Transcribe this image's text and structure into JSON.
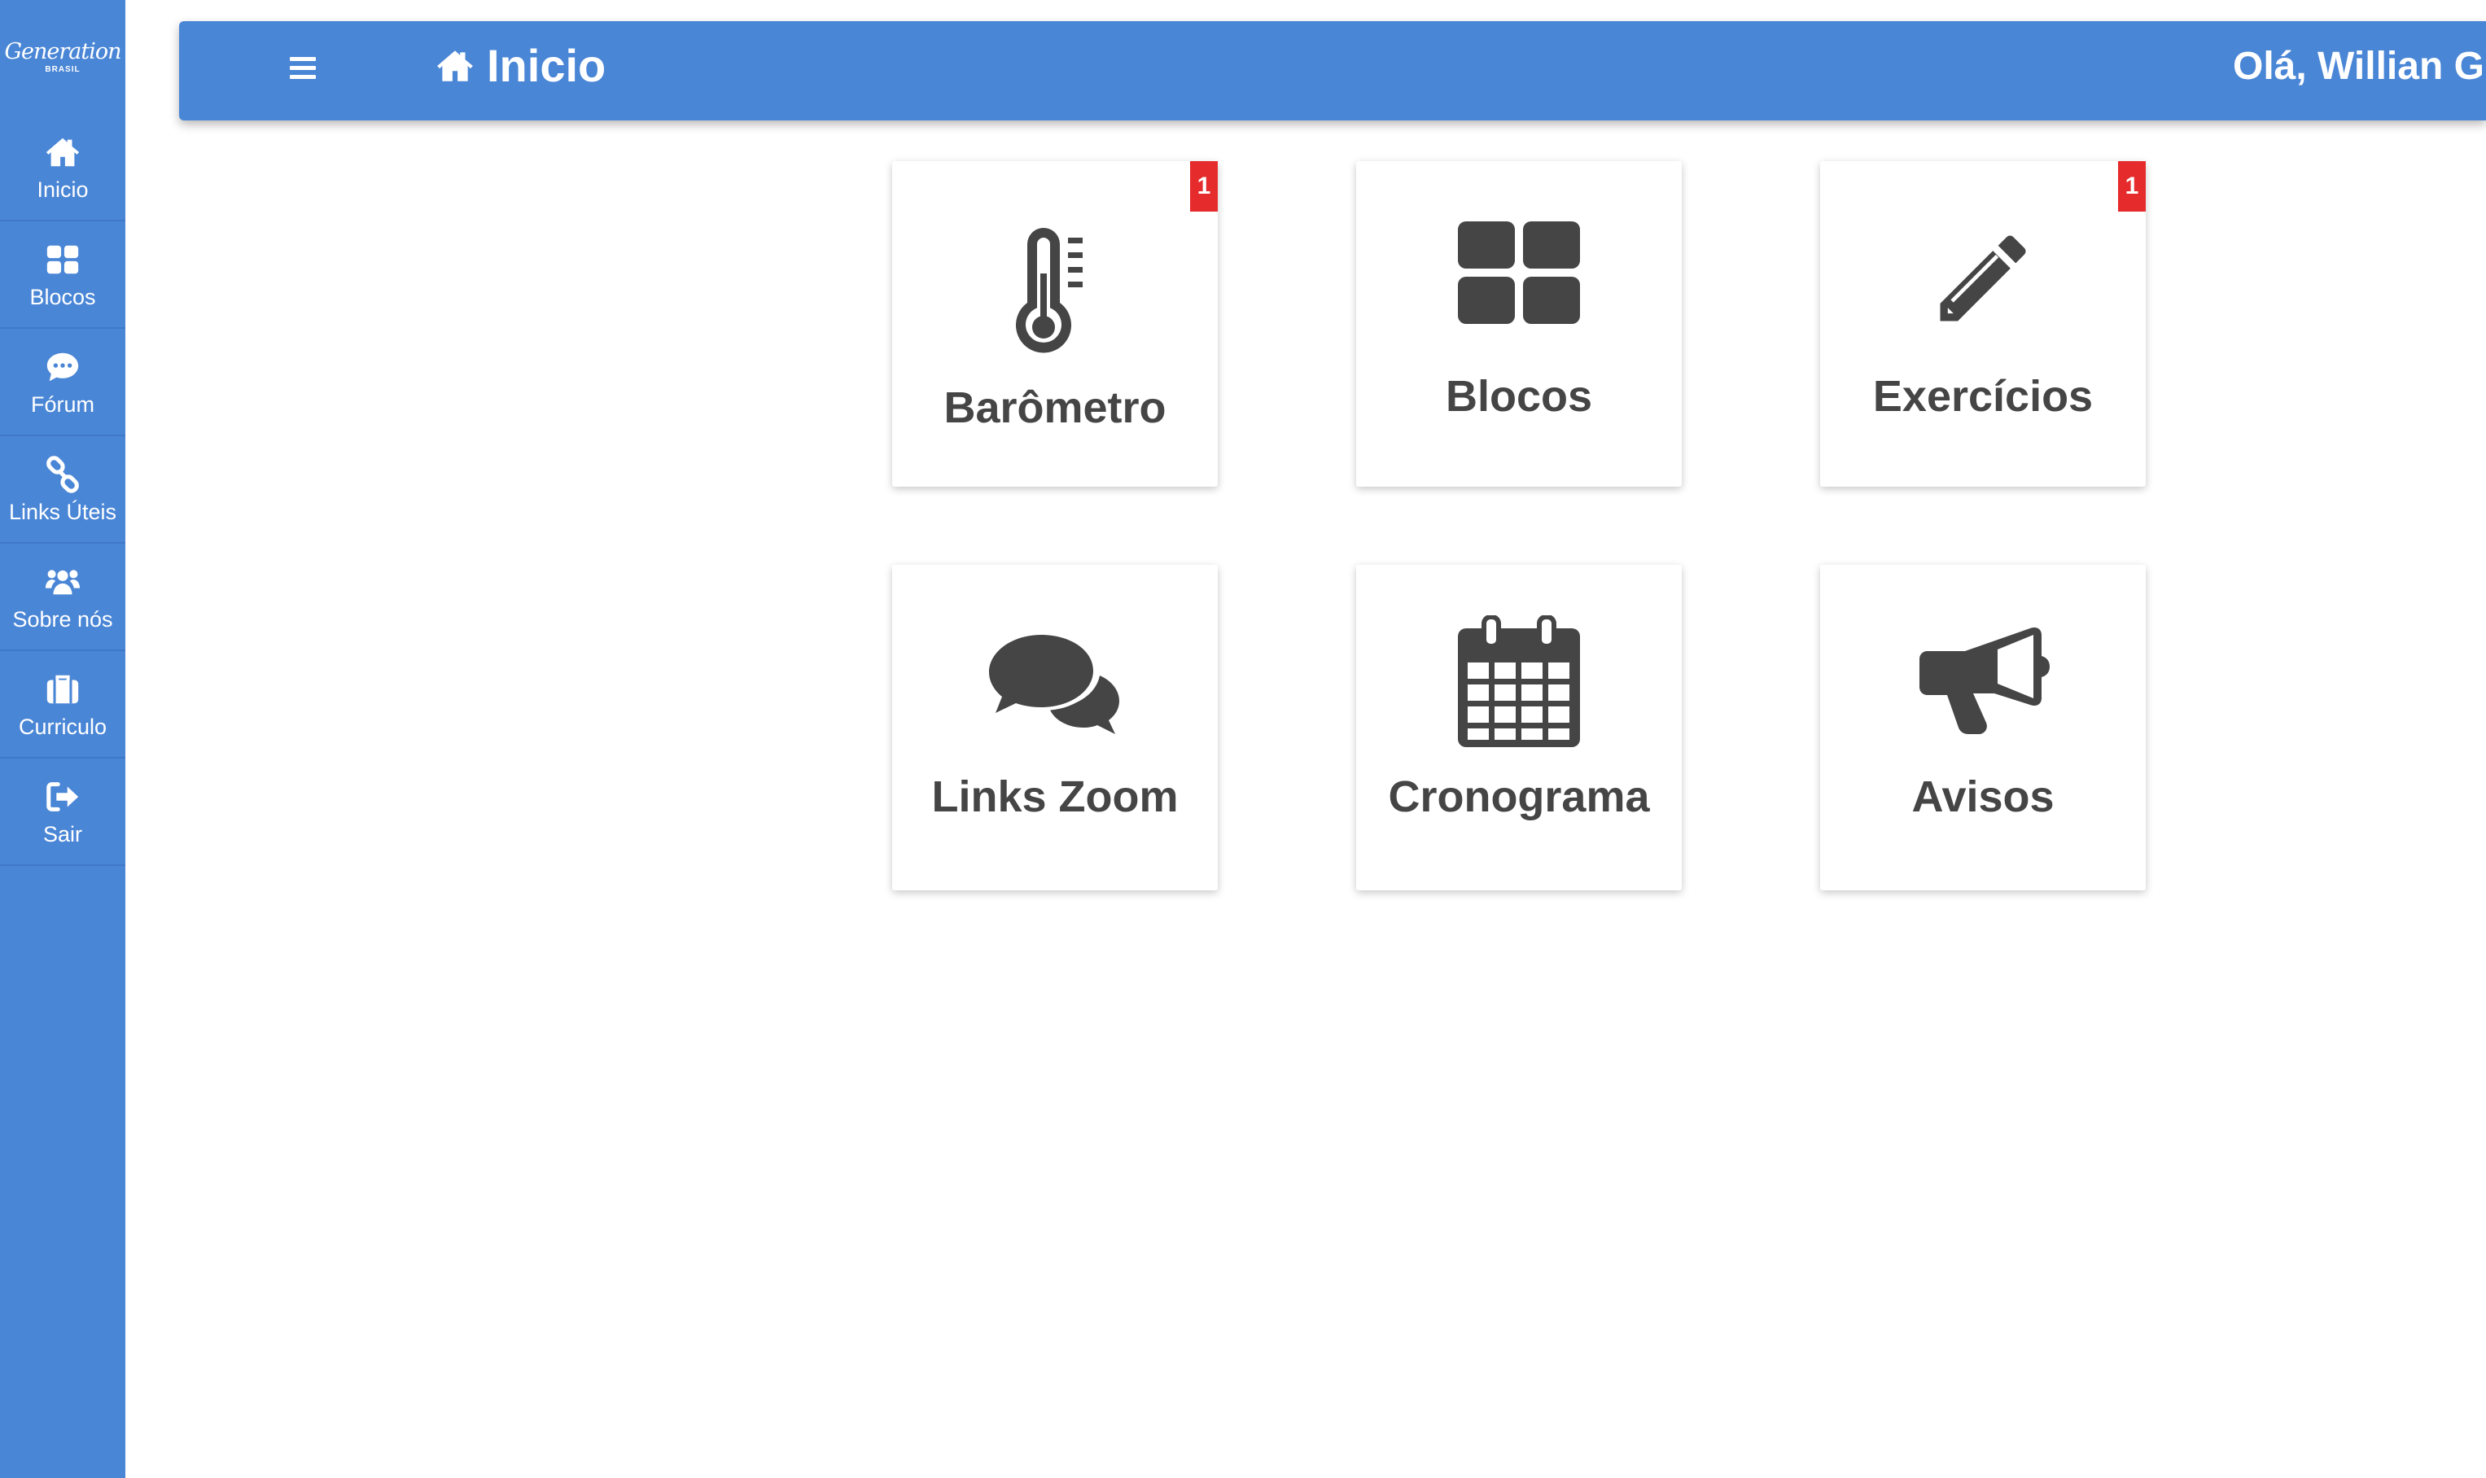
{
  "brand": {
    "name": "Generation",
    "subtitle": "BRASIL"
  },
  "sidebar": {
    "items": [
      {
        "label": "Inicio",
        "icon": "home-icon"
      },
      {
        "label": "Blocos",
        "icon": "grid-icon"
      },
      {
        "label": "Fórum",
        "icon": "comment-icon"
      },
      {
        "label": "Links Úteis",
        "icon": "link-icon"
      },
      {
        "label": "Sobre nós",
        "icon": "users-icon"
      },
      {
        "label": "Curriculo",
        "icon": "briefcase-icon"
      },
      {
        "label": "Sair",
        "icon": "sign-out-icon"
      }
    ]
  },
  "header": {
    "title": "Inicio",
    "title_icon": "home-icon",
    "menu_icon": "hamburger-icon",
    "greeting": "Olá, Willian Gu"
  },
  "cards": [
    {
      "label": "Barômetro",
      "icon": "thermometer-icon",
      "badge": "1"
    },
    {
      "label": "Blocos",
      "icon": "grid-icon"
    },
    {
      "label": "Exercícios",
      "icon": "pencil-icon",
      "badge": "1"
    },
    {
      "label": "Links Zoom",
      "icon": "comments-icon"
    },
    {
      "label": "Cronograma",
      "icon": "calendar-icon"
    },
    {
      "label": "Avisos",
      "icon": "megaphone-icon"
    }
  ],
  "colors": {
    "primary": "#4a86d6",
    "badge": "#e52b2b",
    "card_text": "#454545"
  }
}
